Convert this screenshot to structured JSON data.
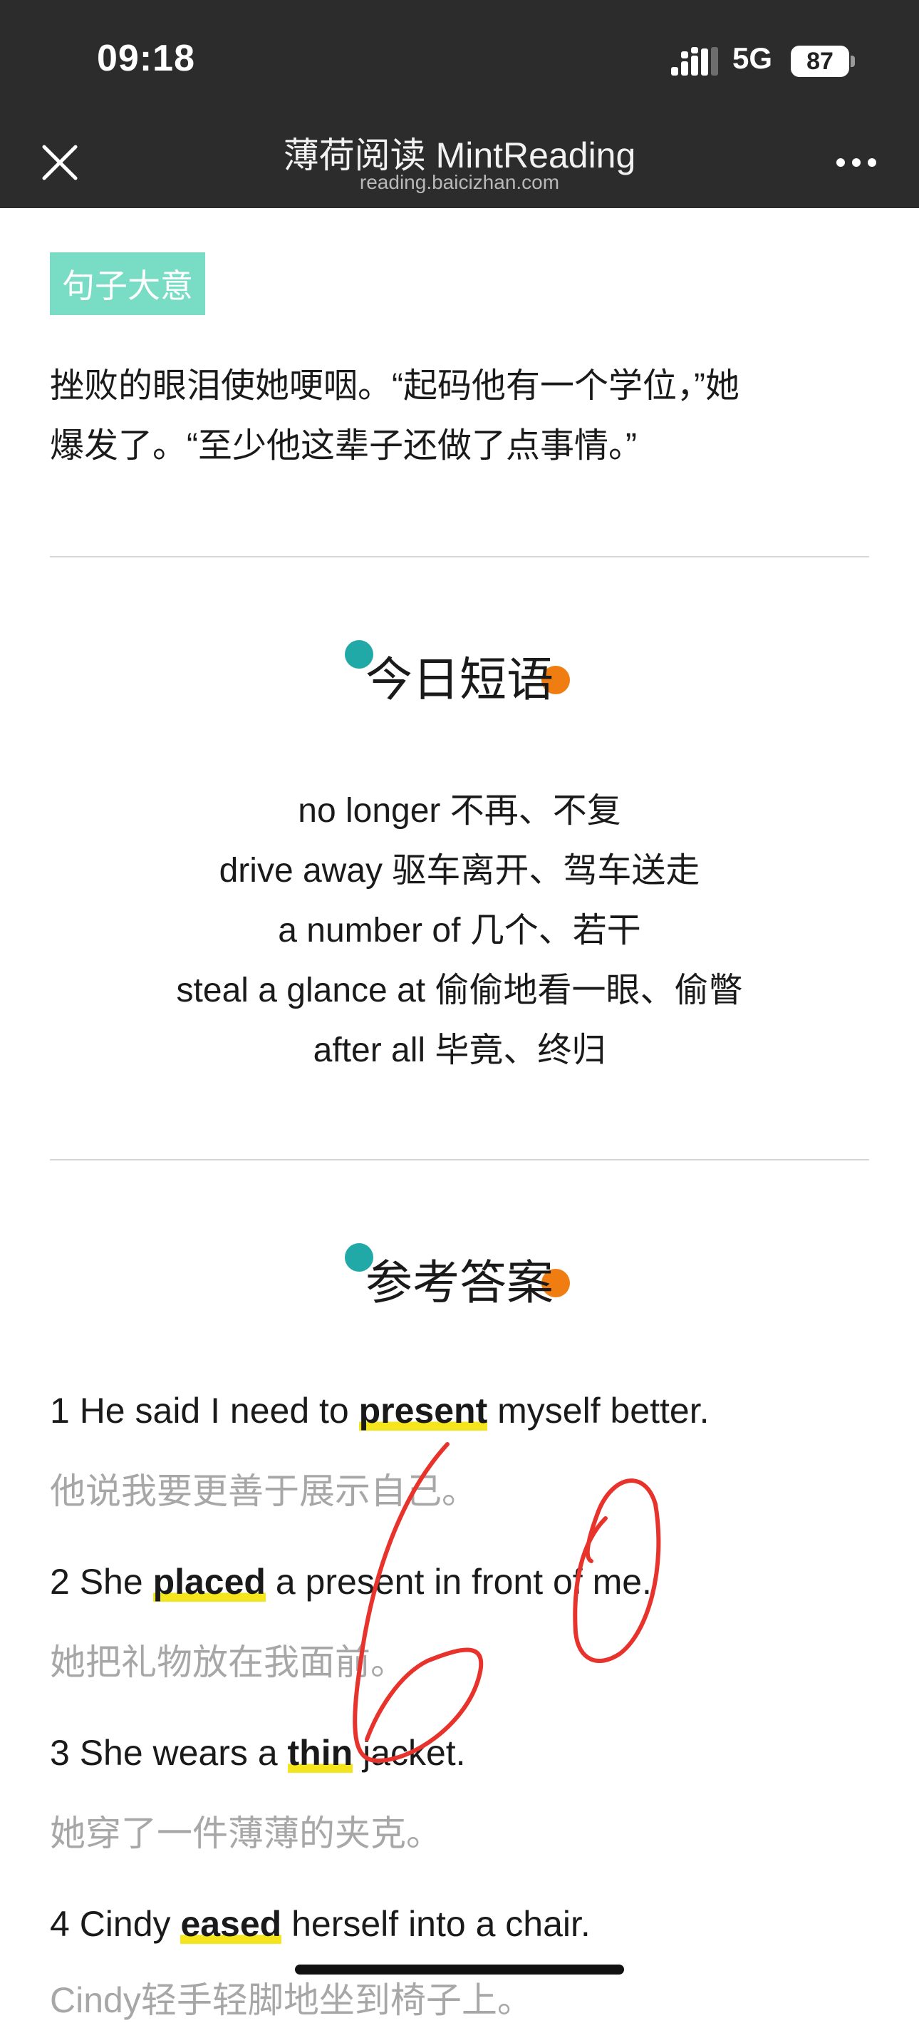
{
  "status_bar": {
    "time": "09:18",
    "network": "5G",
    "battery": "87"
  },
  "nav": {
    "title": "薄荷阅读 MintReading",
    "subtitle": "reading.baicizhan.com"
  },
  "sentence_meaning": {
    "tag": "句子大意",
    "lines": [
      "挫败的眼泪使她哽咽。“起码他有一个学位，”她",
      "爆发了。“至少他这辈子还做了点事情。”"
    ]
  },
  "phrases_section": {
    "heading": "今日短语",
    "items": [
      "no longer 不再、不复",
      "drive away 驱车离开、驾车送走",
      "a number of 几个、若干",
      "steal a glance at 偷偷地看一眼、偷瞥",
      "after all 毕竟、终归"
    ]
  },
  "answers_section": {
    "heading": "参考答案",
    "items": [
      {
        "before": "1 He said I need to ",
        "word": "present",
        "after": " myself better.",
        "cn": "他说我要更善于展示自己。"
      },
      {
        "before": "2 She ",
        "word": "placed",
        "after": " a present in front of me.",
        "cn": "她把礼物放在我面前。"
      },
      {
        "before": "3 She wears a ",
        "word": "thin",
        "after": " jacket.",
        "cn": "她穿了一件薄薄的夹克。"
      },
      {
        "before": "4 Cindy ",
        "word": "eased",
        "after": " herself into a chair.",
        "cn": "Cindy轻手轻脚地坐到椅子上。"
      }
    ]
  },
  "handwritten_score": "60",
  "colors": {
    "accent_tag": "#79dcc5",
    "highlight": "#f5e51c",
    "ink": "#e8322c",
    "topbar": "#2c2c2c"
  }
}
